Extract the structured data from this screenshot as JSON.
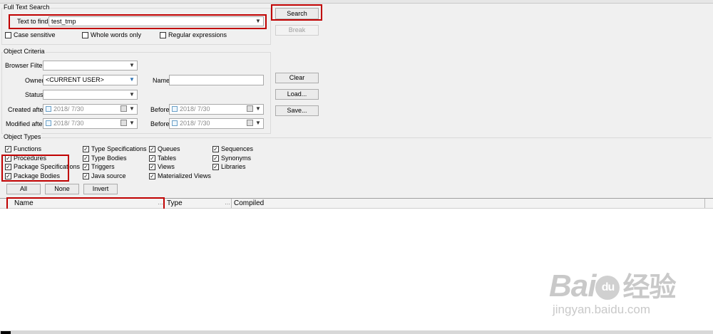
{
  "full_text_search": {
    "legend": "Full Text Search",
    "text_to_find_label": "Text to find",
    "text_to_find_value": "test_tmp",
    "case_sensitive_label": "Case sensitive",
    "whole_words_label": "Whole words only",
    "regex_label": "Regular expressions",
    "case_sensitive_checked": false,
    "whole_words_checked": false,
    "regex_checked": false
  },
  "buttons": {
    "search": "Search",
    "break": "Break",
    "clear": "Clear",
    "load": "Load...",
    "save": "Save...",
    "all": "All",
    "none": "None",
    "invert": "Invert"
  },
  "object_criteria": {
    "legend": "Object Criteria",
    "browser_filter_label": "Browser Filter",
    "browser_filter_value": "",
    "owner_label": "Owner",
    "owner_value": "<CURRENT USER>",
    "name_label": "Name",
    "name_value": "",
    "status_label": "Status",
    "status_value": "",
    "created_after_label": "Created after",
    "created_after_value": "2018/  7/30",
    "created_before_label": "Before",
    "created_before_value": "2018/  7/30",
    "modified_after_label": "Modified after",
    "modified_after_value": "2018/  7/30",
    "modified_before_label": "Before",
    "modified_before_value": "2018/  7/30"
  },
  "object_types": {
    "legend": "Object Types",
    "col1": [
      "Functions",
      "Procedures",
      "Package Specifications",
      "Package Bodies"
    ],
    "col2": [
      "Type Specifications",
      "Type Bodies",
      "Triggers",
      "Java source"
    ],
    "col3": [
      "Queues",
      "Tables",
      "Views",
      "Materialized Views"
    ],
    "col4": [
      "Sequences",
      "Synonyms",
      "Libraries"
    ],
    "all_checked": true
  },
  "results_columns": {
    "name": "Name",
    "type": "Type",
    "compiled": "Compiled"
  },
  "watermark": {
    "brand": "Bai",
    "brand2": "du",
    "brand_cn": "经验",
    "url": "jingyan.baidu.com"
  },
  "colors": {
    "panel_bg": "#f0f0f0",
    "highlight_red": "#c00000",
    "selection_blue": "#0078d7"
  }
}
